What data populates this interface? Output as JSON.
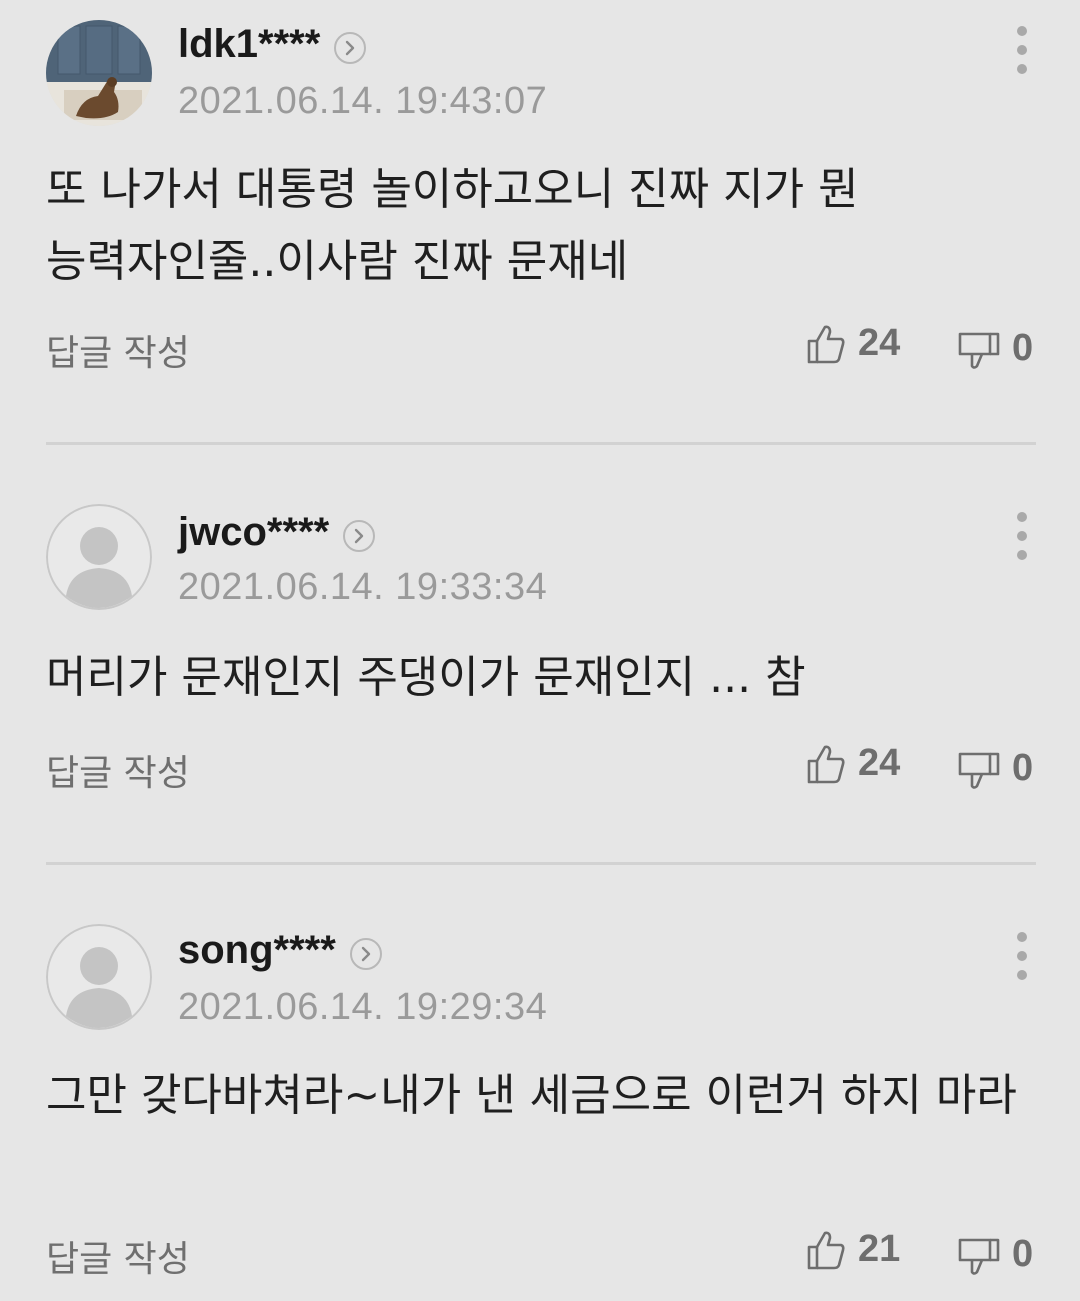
{
  "comments": [
    {
      "username": "ldk1****",
      "avatar": "dog-photo-avatar",
      "timestamp": "2021.06.14. 19:43:07",
      "text": "또 나가서 대통령 놀이하고오니 진짜 지가 뭔 능력자인줄..이사람 진짜 문재네",
      "reply_label": "답글 작성",
      "likes": "24",
      "dislikes": "0"
    },
    {
      "username": "jwco****",
      "avatar": "default-person-avatar",
      "timestamp": "2021.06.14. 19:33:34",
      "text": "머리가 문재인지 주댕이가 문재인지 ... 참",
      "reply_label": "답글 작성",
      "likes": "24",
      "dislikes": "0"
    },
    {
      "username": "song****",
      "avatar": "default-person-avatar",
      "timestamp": "2021.06.14. 19:29:34",
      "text": "그만 갖다바쳐라~내가 낸 세금으로 이런거 하지 마라",
      "reply_label": "답글 작성",
      "likes": "21",
      "dislikes": "0"
    }
  ],
  "icons": {
    "profile": "chevron-right-icon",
    "more": "more-vertical-icon",
    "like": "thumbs-up-icon",
    "dislike": "thumbs-down-icon"
  },
  "colors": {
    "background": "#e6e6e6",
    "text": "#1f1f1f",
    "muted": "#9a9a9a",
    "icon": "#6e6e6e",
    "divider": "#d2d2d2"
  }
}
